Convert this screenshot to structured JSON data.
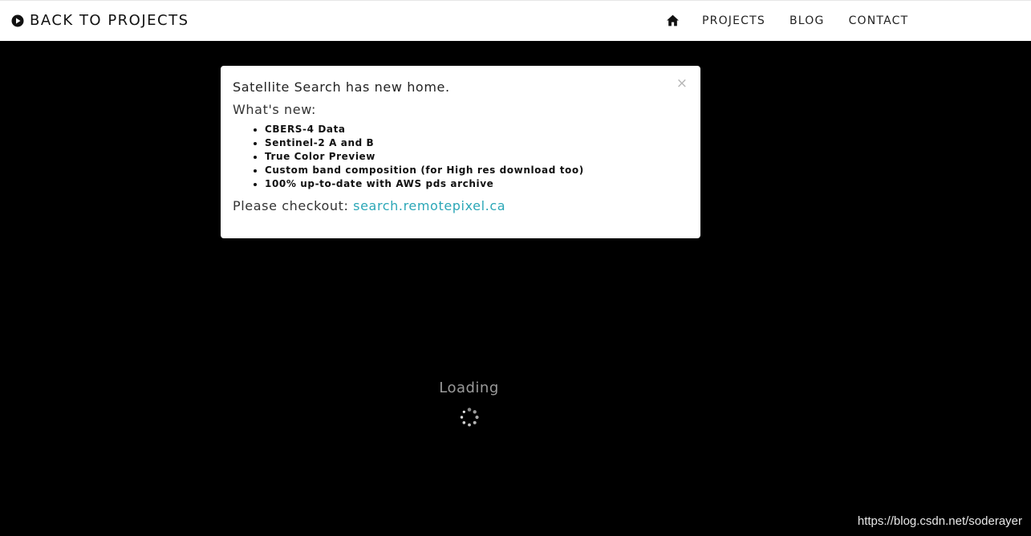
{
  "topbar": {
    "back_label": "BACK TO PROJECTS",
    "nav": {
      "home_icon": "home-icon",
      "projects": "PROJECTS",
      "blog": "BLOG",
      "contact": "CONTACT"
    }
  },
  "modal": {
    "close_symbol": "×",
    "headline": "Satellite Search has new home.",
    "whats_new": "What's new:",
    "features": [
      "CBERS-4 Data",
      "Sentinel-2 A and B",
      "True Color Preview",
      "Custom band composition (for High res download too)",
      "100% up-to-date with AWS pds archive"
    ],
    "checkout_prefix": "Please checkout: ",
    "checkout_link": "search.remotepixel.ca"
  },
  "loading": {
    "label": "Loading"
  },
  "watermark": "https://blog.csdn.net/soderayer",
  "colors": {
    "background": "#000000",
    "topbar": "#ffffff",
    "link": "#2ba7b7",
    "loading_text": "#9a9a9a"
  }
}
